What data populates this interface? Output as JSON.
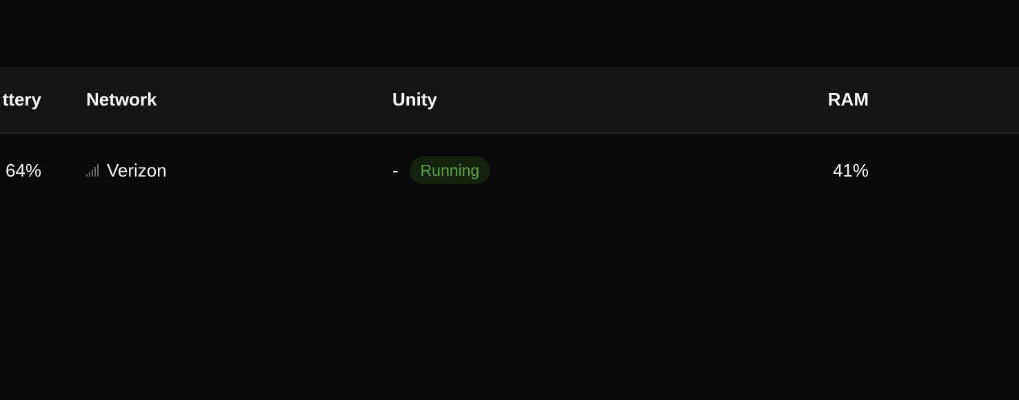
{
  "table": {
    "headers": {
      "battery": "ttery",
      "network": "Network",
      "unity": "Unity",
      "ram": "RAM"
    },
    "rows": [
      {
        "battery": "64%",
        "network": {
          "icon": "signal-bars-icon",
          "carrier": "Verizon"
        },
        "unity": {
          "value": "-",
          "status": "Running",
          "status_color": "#58a843"
        },
        "ram": "41%"
      }
    ]
  }
}
